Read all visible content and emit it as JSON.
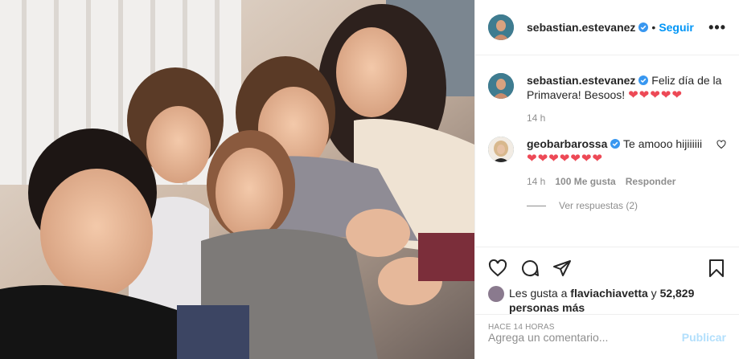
{
  "post": {
    "author": "sebastian.estevanez",
    "follow_label": "Seguir",
    "dot": "•",
    "more_label": "•••"
  },
  "caption": {
    "username": "sebastian.estevanez",
    "text": "Feliz día de la Primavera! Besoos!",
    "emoji": "❤❤❤❤❤",
    "time": "14 h"
  },
  "comment": {
    "username": "geobarbarossa",
    "text": "Te amooo hijiiiiii",
    "emoji": "❤❤❤❤❤❤❤",
    "time": "14 h",
    "likes": "100 Me gusta",
    "reply_label": "Responder",
    "view_replies": "Ver respuestas (2)"
  },
  "likes": {
    "prefix": "Les gusta a",
    "user": "flaviachiavetta",
    "conj": "y",
    "count": "52,829 personas más"
  },
  "time_ago": "HACE 14 HORAS",
  "add_comment": {
    "placeholder": "Agrega un comentario...",
    "publish_label": "Publicar"
  },
  "colors": {
    "link": "#0095f6",
    "publish_disabled": "#b2dffc",
    "verified": "#3897f0",
    "heart": "#ed4956"
  }
}
